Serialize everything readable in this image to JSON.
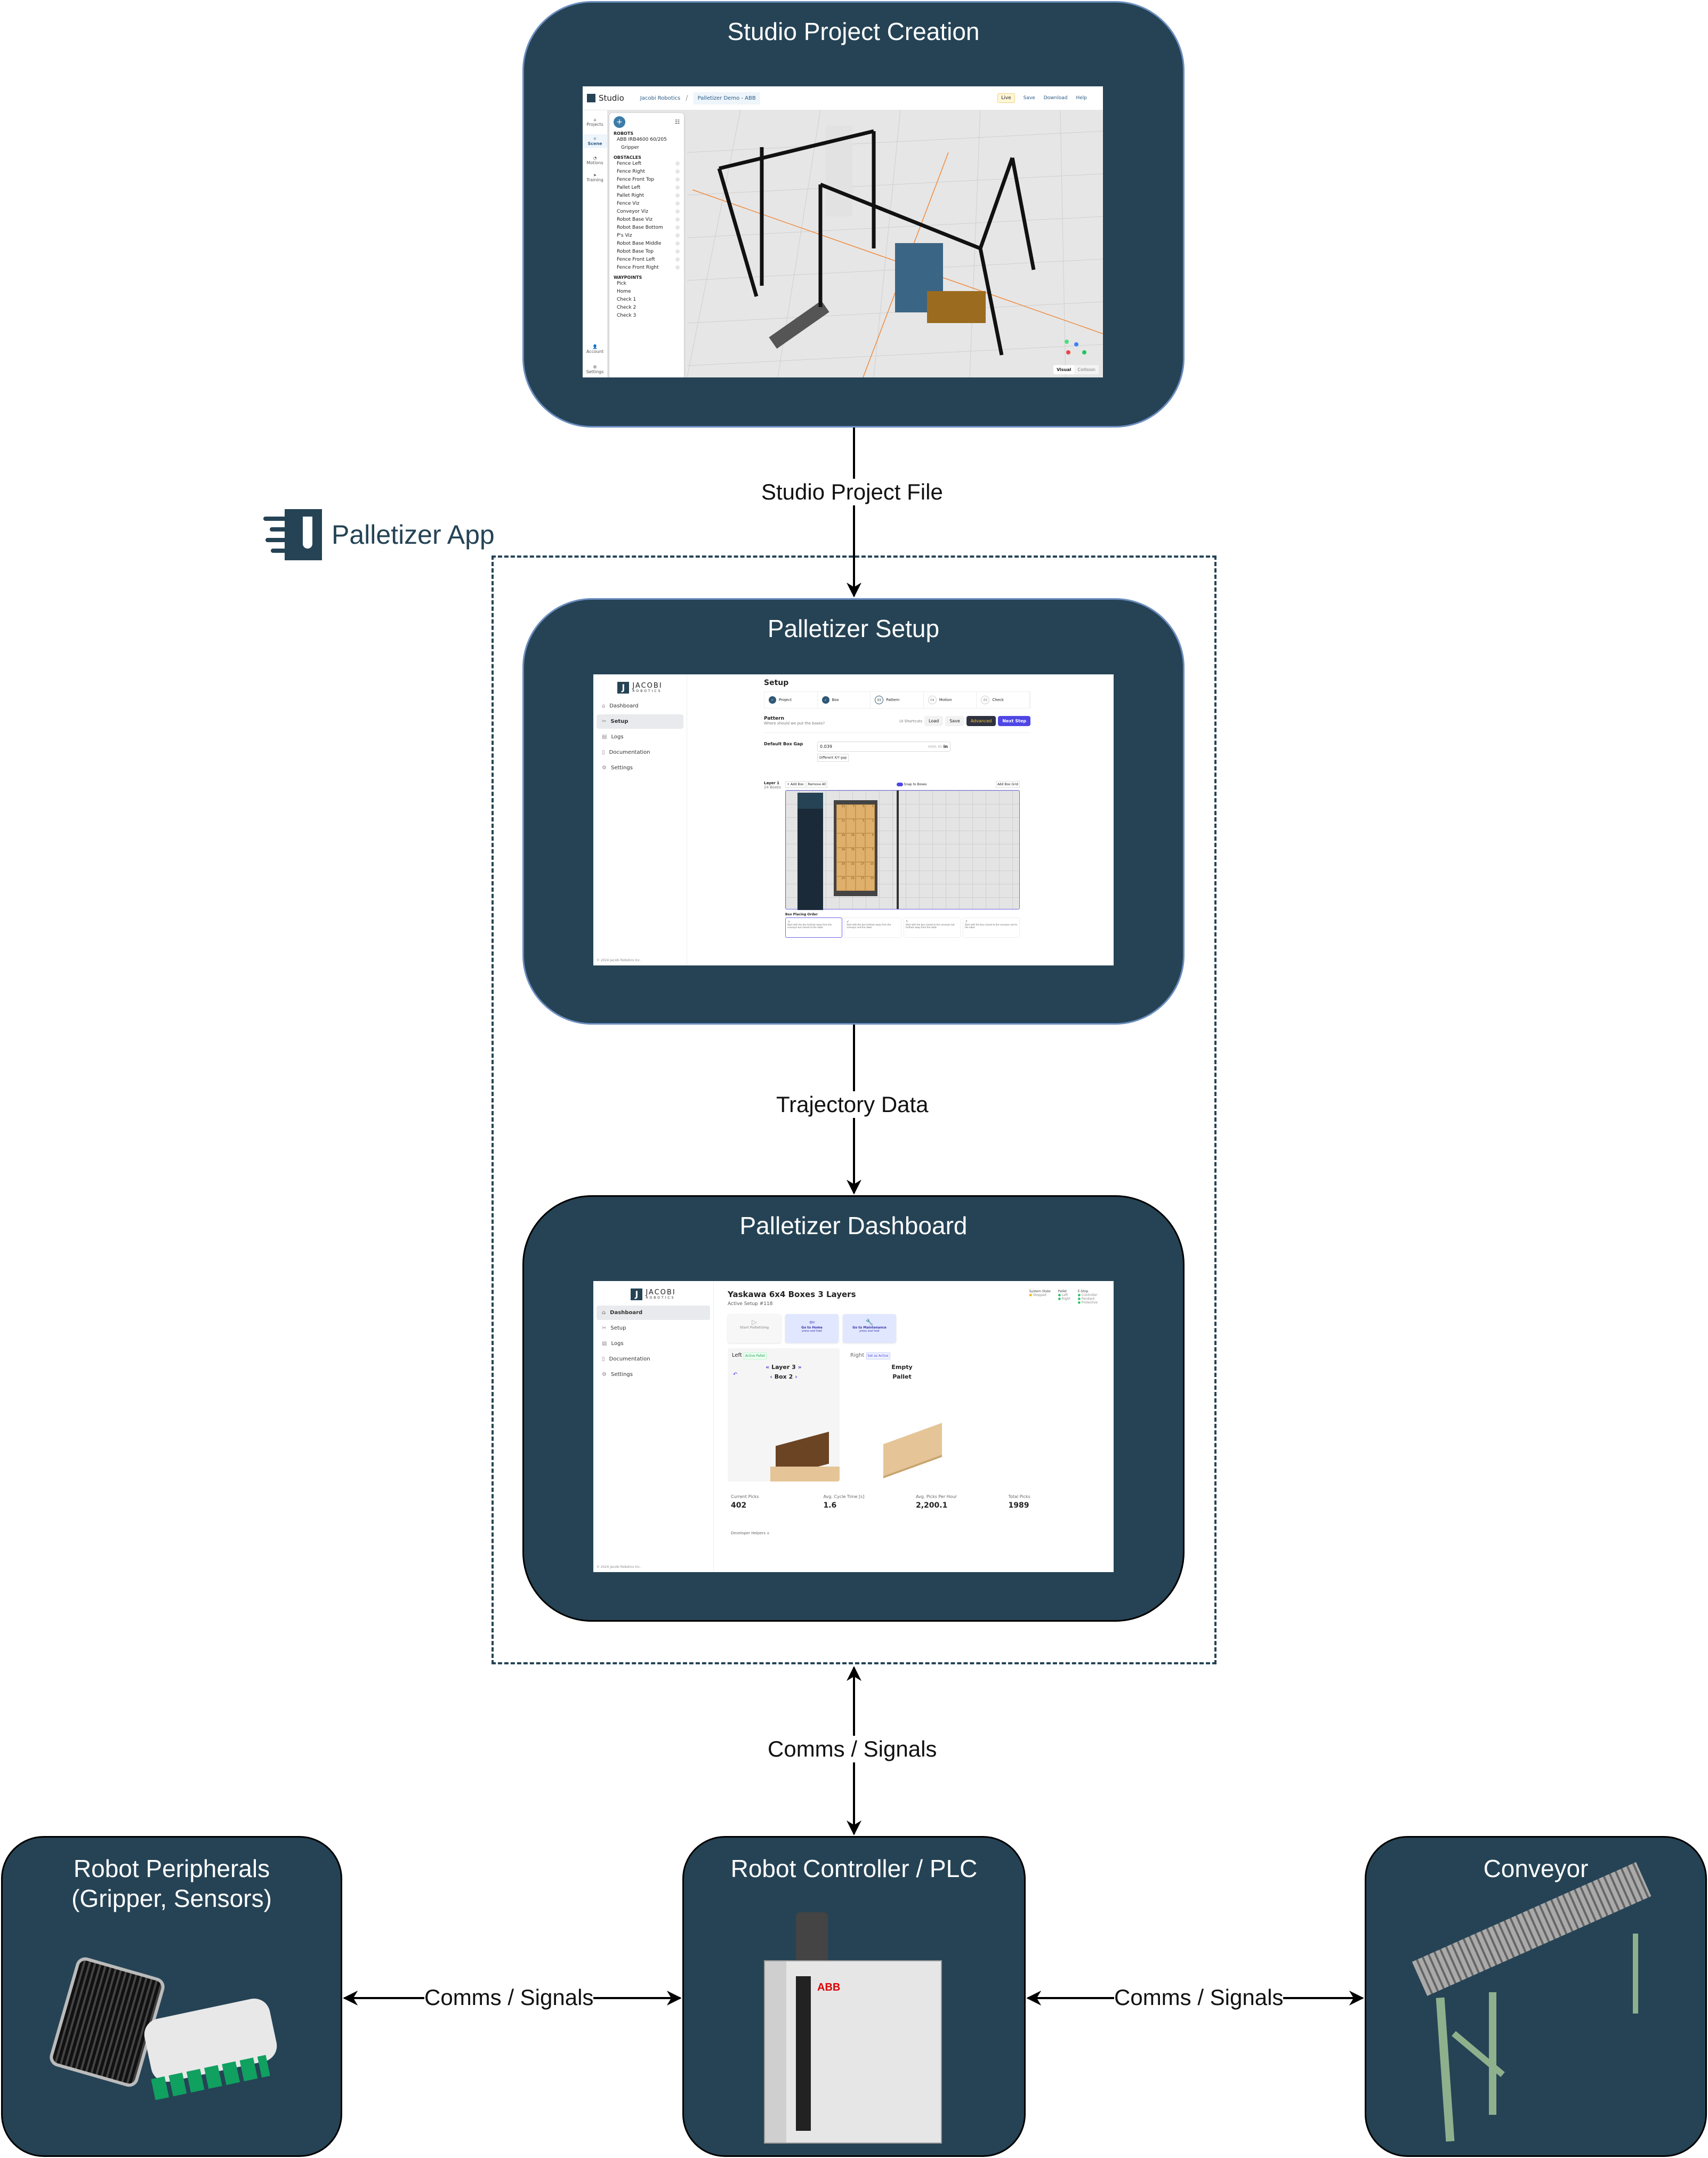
{
  "diagram": {
    "group_label": "Palletizer App",
    "colors": {
      "node_fill": "#254355",
      "node_border_blue": "#6c8ebf",
      "node_border_dark": "#000000",
      "accent": "#4f46e5"
    },
    "nodes": {
      "studio": {
        "title": "Studio Project Creation"
      },
      "setup": {
        "title": "Palletizer Setup"
      },
      "dashboard": {
        "title": "Palletizer Dashboard"
      },
      "peripherals": {
        "title_line1": "Robot Peripherals",
        "title_line2": "(Gripper, Sensors)",
        "image": "gripper-image"
      },
      "controller": {
        "title": "Robot Controller / PLC",
        "image": "robot-controller-cabinet-image"
      },
      "conveyor": {
        "title": "Conveyor",
        "image": "roller-conveyor-image"
      }
    },
    "edges": [
      {
        "from": "studio",
        "to": "setup",
        "label": "Studio Project File",
        "direction": "forward"
      },
      {
        "from": "setup",
        "to": "dashboard",
        "label": "Trajectory Data",
        "direction": "forward"
      },
      {
        "from": "palletizer-app",
        "to": "controller",
        "label": "Comms / Signals",
        "direction": "both"
      },
      {
        "from": "peripherals",
        "to": "controller",
        "label": "Comms / Signals",
        "direction": "both"
      },
      {
        "from": "controller",
        "to": "conveyor",
        "label": "Comms / Signals",
        "direction": "both"
      }
    ]
  },
  "studio_screen": {
    "app_name": "Studio",
    "breadcrumb": [
      "Jacobi Robotics",
      "Palletizer Demo - ABB"
    ],
    "top_actions": [
      "Live",
      "Save",
      "Download",
      "Help"
    ],
    "rail": [
      "Projects",
      "Scene",
      "Motions",
      "Training",
      "Account",
      "Settings"
    ],
    "active_rail": "Scene",
    "panel": {
      "robots_header": "ROBOTS",
      "robots": [
        "ABB IRB4600 60/205",
        "Gripper"
      ],
      "obstacles_header": "OBSTACLES",
      "obstacles": [
        "Fence Left",
        "Fence Right",
        "Fence Front Top",
        "Pallet Left",
        "Pallet Right",
        "Fence Viz",
        "Conveyor Viz",
        "Robot Base Viz",
        "Robot Base Bottom",
        "P's Viz",
        "Robot Base Middle",
        "Robot Base Top",
        "Fence Front Left",
        "Fence Front Right"
      ],
      "waypoints_header": "WAYPOINTS",
      "waypoints": [
        "Pick",
        "Home",
        "Check 1",
        "Check 2",
        "Check 3"
      ]
    },
    "view_toggle": [
      "Visual",
      "Collision"
    ],
    "active_view": "Visual"
  },
  "setup_screen": {
    "brand": {
      "line1": "JACOBI",
      "line2": "ROBOTICS"
    },
    "nav": [
      "Dashboard",
      "Setup",
      "Logs",
      "Documentation",
      "Settings"
    ],
    "active_nav": "Setup",
    "footer": "© 2024 Jacobi Robotics Inc.",
    "title": "Setup",
    "steps": [
      {
        "num": "✓",
        "label": "Project",
        "state": "done"
      },
      {
        "num": "✓",
        "label": "Box",
        "state": "done"
      },
      {
        "num": "03",
        "label": "Pattern",
        "state": "current"
      },
      {
        "num": "04",
        "label": "Motion",
        "state": "todo"
      },
      {
        "num": "05",
        "label": "Check",
        "state": "todo"
      }
    ],
    "section_title": "Pattern",
    "section_subtitle": "Where should we put the boxes?",
    "actions": {
      "shortcuts": "UI Shortcuts",
      "load": "Load",
      "save": "Save",
      "advanced": "Advanced",
      "next": "Next Step"
    },
    "box_gap": {
      "label": "Default Box Gap",
      "value": "0.039",
      "units": [
        "mm",
        "m",
        "in"
      ],
      "active_unit": "in",
      "xy_button": "Different X/Y gap"
    },
    "layer": {
      "title": "Layer 1",
      "count": "24 Boxes",
      "add_box": "+ Add Box",
      "remove_all": "Remove All",
      "snap": "Snap to Boxes",
      "snap_on": true,
      "add_grid": "Add Box Grid"
    },
    "box_grid": [
      [
        "11",
        "7",
        "3",
        "1"
      ],
      [
        "11",
        "7",
        "3",
        "1"
      ],
      [
        "19",
        "15",
        "9",
        "5"
      ],
      [
        "19",
        "15",
        "9",
        "5"
      ],
      [
        "23",
        "21",
        "17",
        "13"
      ],
      [
        "23",
        "21",
        "17",
        "13"
      ]
    ],
    "placing_order": {
      "title": "Box Placing Order",
      "options": [
        "Start with the box furthest away from the conveyor but closest to the robot.",
        "Start with the box furthest away from the conveyor and the robot.",
        "Start with the box closest to the conveyor but furthest away from the robot.",
        "Start with the box closest to the conveyor and to the robot."
      ],
      "selected": 0
    }
  },
  "dashboard_screen": {
    "title": "Yaskawa 6x4 Boxes 3 Layers",
    "subtitle": "Active Setup #118",
    "nav": [
      "Dashboard",
      "Setup",
      "Logs",
      "Documentation",
      "Settings"
    ],
    "active_nav": "Dashboard",
    "footer": "© 2024 Jacobi Robotics Inc.",
    "status": {
      "system_state": {
        "label": "System State",
        "value": "Stopped",
        "color": "#eab308"
      },
      "pallet": {
        "label": "Pallet",
        "items": [
          "Left",
          "Right"
        ],
        "color": "#22c55e"
      },
      "estop": {
        "label": "E-Stop",
        "items": [
          "Controller",
          "Pendant",
          "Protective"
        ],
        "color": "#22c55e"
      }
    },
    "actions": [
      {
        "label": "Start Palletizing",
        "hint": "",
        "icon": "play-icon",
        "enabled": false
      },
      {
        "label": "Go to Home",
        "hint": "press and hold",
        "icon": "home-enter-icon",
        "enabled": true
      },
      {
        "label": "Go to Maintenance",
        "hint": "press and hold",
        "icon": "wrench-icon",
        "enabled": true
      }
    ],
    "left_pallet": {
      "side": "Left",
      "badge": "Active Pallet",
      "layer": "Layer 3",
      "box": "Box 2"
    },
    "right_pallet": {
      "side": "Right",
      "badge": "Set as Active",
      "line1": "Empty",
      "line2": "Pallet"
    },
    "stats": [
      {
        "label": "Current Picks",
        "value": "402"
      },
      {
        "label": "Avg. Cycle Time [s]",
        "value": "1.6"
      },
      {
        "label": "Avg. Picks Per Hour",
        "value": "2,200.1"
      },
      {
        "label": "Total Picks",
        "value": "1989"
      }
    ],
    "developer_helpers": "Developer Helpers ∨"
  }
}
